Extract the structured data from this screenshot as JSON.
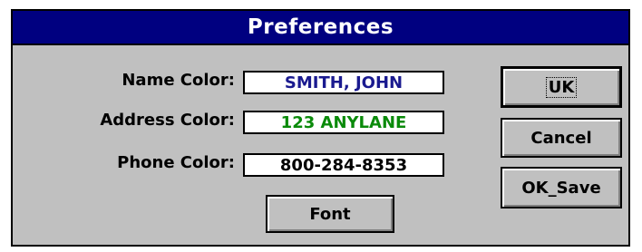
{
  "dialog": {
    "title": "Preferences"
  },
  "fields": [
    {
      "label": "Name Color:",
      "value": "SMITH, JOHN",
      "color": "#1a1a8f"
    },
    {
      "label": "Address Color:",
      "value": "123 ANYLANE",
      "color": "#0a8a0a"
    },
    {
      "label": "Phone Color:",
      "value": "800-284-8353",
      "color": "#000000"
    }
  ],
  "buttons": {
    "ok_label": "UK",
    "cancel_label": "Cancel",
    "ok_save_label": "OK_Save",
    "font_label": "Font"
  },
  "colors": {
    "title_bar": "#000080",
    "dialog_bg": "#c0c0c0"
  }
}
